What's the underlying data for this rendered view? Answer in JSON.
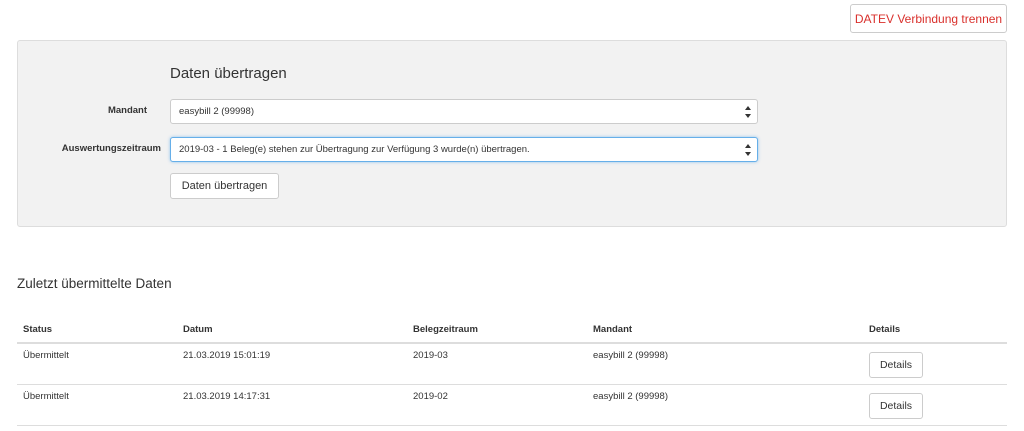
{
  "header": {
    "disconnect_label": "DATEV Verbindung trennen",
    "disconnect_color": "#d9302c"
  },
  "form": {
    "title": "Daten übertragen",
    "mandant_label": "Mandant",
    "mandant_value": "easybill 2 (99998)",
    "zeitraum_label": "Auswertungszeitraum",
    "zeitraum_value": "2019-03 - 1 Beleg(e) stehen zur Übertragung zur Verfügung 3 wurde(n) übertragen.",
    "submit_label": "Daten übertragen",
    "select_arrow_icon": "updown-arrows-icon"
  },
  "history": {
    "title": "Zuletzt übermittelte Daten",
    "columns": [
      "Status",
      "Datum",
      "Belegzeitraum",
      "Mandant",
      "Details"
    ],
    "rows": [
      {
        "status": "Übermittelt",
        "datum": "21.03.2019 15:01:19",
        "zeitraum": "2019-03",
        "mandant": "easybill 2 (99998)",
        "details_label": "Details"
      },
      {
        "status": "Übermittelt",
        "datum": "21.03.2019 14:17:31",
        "zeitraum": "2019-02",
        "mandant": "easybill 2 (99998)",
        "details_label": "Details"
      }
    ]
  }
}
